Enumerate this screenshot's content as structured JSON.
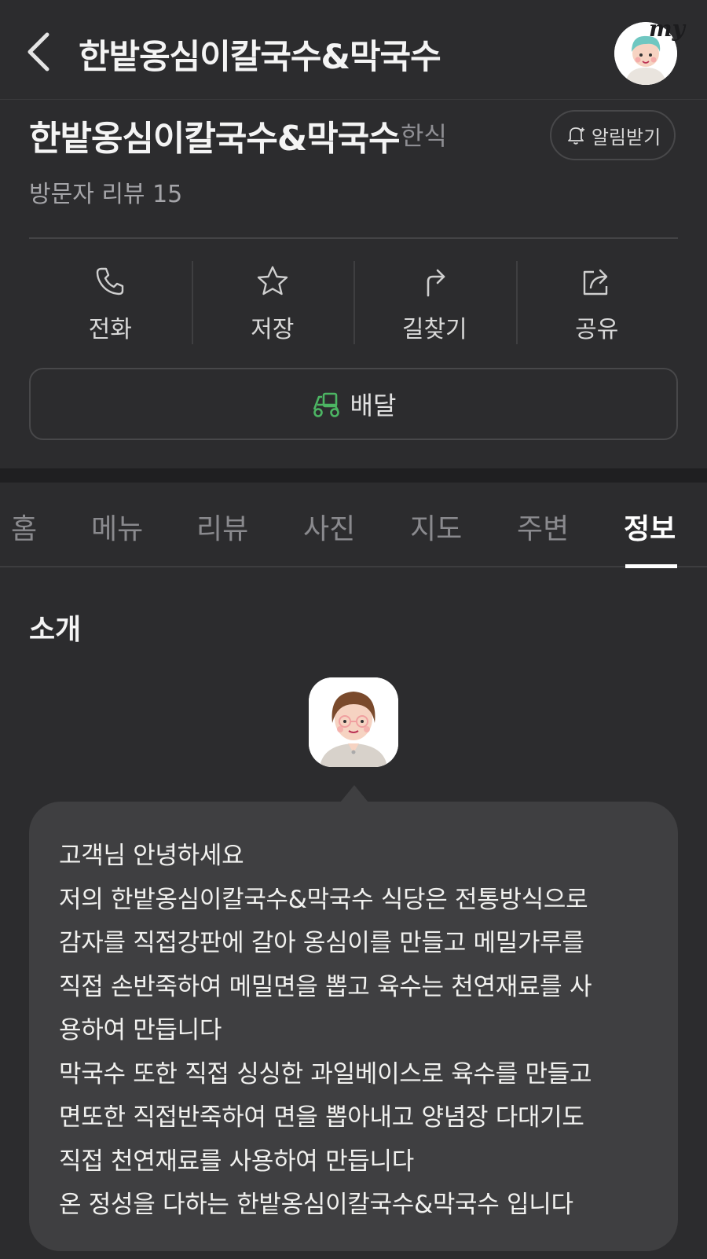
{
  "header": {
    "title": "한밭옹심이칼국수&막국수",
    "my_badge": "my"
  },
  "place": {
    "name": "한밭옹심이칼국수&막국수",
    "category": "한식",
    "alarm_label": "알림받기",
    "visitor_review": "방문자 리뷰 15"
  },
  "actions": [
    {
      "label": "전화",
      "icon": "phone-icon"
    },
    {
      "label": "저장",
      "icon": "star-icon"
    },
    {
      "label": "길찾기",
      "icon": "directions-icon"
    },
    {
      "label": "공유",
      "icon": "share-icon"
    }
  ],
  "delivery": {
    "label": "배달",
    "icon": "delivery-scooter-icon",
    "icon_color": "#4cb563"
  },
  "tabs": [
    {
      "label": "홈"
    },
    {
      "label": "메뉴"
    },
    {
      "label": "리뷰"
    },
    {
      "label": "사진"
    },
    {
      "label": "지도"
    },
    {
      "label": "주변"
    },
    {
      "label": "정보",
      "active": true
    }
  ],
  "intro": {
    "title": "소개",
    "lines": [
      "고객님 안녕하세요",
      "저의 한밭옹심이칼국수&막국수 식당은 전통방식으로",
      "감자를 직접강판에 갈아 옹심이를 만들고 메밀가루를",
      "직접 손반죽하여 메밀면을 뽑고 육수는 천연재료를 사",
      "용하여 만듭니다",
      "막국수 또한 직접 싱싱한 과일베이스로 육수를 만들고",
      "면또한 직접반죽하여 면을 뽑아내고 양념장 다대기도",
      "직접 천연재료를 사용하여 만듭니다",
      "온 정성을 다하는 한밭옹심이칼국수&막국수 입니다"
    ]
  },
  "colors": {
    "background": "#2c2c2e",
    "bubble": "#3f3f41",
    "active_tab": "#ffffff",
    "inactive_tab": "#8a8a8e"
  }
}
